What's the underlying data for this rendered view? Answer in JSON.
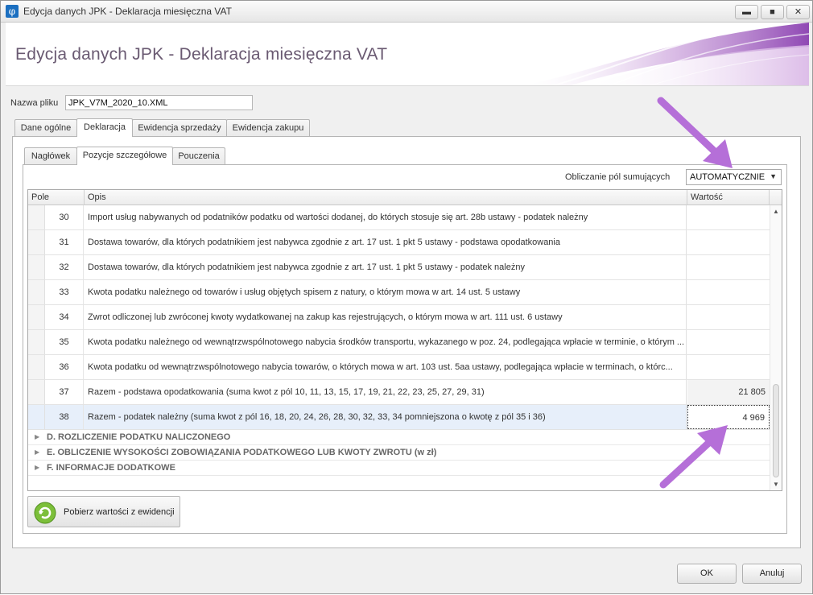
{
  "window": {
    "title": "Edycja danych JPK - Deklaracja miesięczna VAT",
    "buttons": {
      "minimize": "▬",
      "maximize": "■",
      "close": "✕"
    }
  },
  "header": {
    "title": "Edycja danych JPK - Deklaracja miesięczna VAT"
  },
  "file": {
    "label": "Nazwa pliku",
    "value": "JPK_V7M_2020_10.XML"
  },
  "main_tabs": [
    {
      "label": "Dane ogólne"
    },
    {
      "label": "Deklaracja"
    },
    {
      "label": "Ewidencja sprzedaży"
    },
    {
      "label": "Ewidencja zakupu"
    }
  ],
  "sub_tabs": [
    {
      "label": "Nagłówek"
    },
    {
      "label": "Pozycje szczegółowe"
    },
    {
      "label": "Pouczenia"
    }
  ],
  "calc": {
    "label": "Obliczanie pól sumujących",
    "value": "AUTOMATYCZNIE"
  },
  "grid": {
    "columns": {
      "pole": "Pole",
      "opis": "Opis",
      "wartosc": "Wartość"
    },
    "rows": [
      {
        "pole": "30",
        "opis": "Import usług nabywanych od podatników podatku od wartości dodanej, do których stosuje się art. 28b ustawy - podatek należny",
        "wartosc": ""
      },
      {
        "pole": "31",
        "opis": "Dostawa towarów, dla których podatnikiem jest nabywca zgodnie z art. 17 ust. 1 pkt 5 ustawy - podstawa opodatkowania",
        "wartosc": ""
      },
      {
        "pole": "32",
        "opis": "Dostawa towarów, dla których podatnikiem jest nabywca zgodnie z art. 17 ust. 1 pkt 5 ustawy - podatek należny",
        "wartosc": ""
      },
      {
        "pole": "33",
        "opis": "Kwota podatku należnego od towarów i usług objętych spisem z natury, o którym mowa w art. 14 ust. 5 ustawy",
        "wartosc": ""
      },
      {
        "pole": "34",
        "opis": "Zwrot odliczonej lub zwróconej kwoty wydatkowanej na zakup kas rejestrujących, o którym mowa w art. 111 ust. 6 ustawy",
        "wartosc": ""
      },
      {
        "pole": "35",
        "opis": "Kwota podatku należnego od wewnątrzwspólnotowego nabycia środków transportu, wykazanego w poz. 24, podlegająca wpłacie w terminie, o którym ...",
        "wartosc": ""
      },
      {
        "pole": "36",
        "opis": "Kwota podatku od wewnątrzwspólnotowego nabycia towarów, o których mowa w art. 103 ust. 5aa ustawy, podlegająca wpłacie w terminach, o którc...",
        "wartosc": ""
      },
      {
        "pole": "37",
        "opis": "Razem - podstawa opodatkowania (suma kwot z pól 10, 11, 13, 15, 17, 19, 21, 22, 23, 25, 27, 29, 31)",
        "wartosc": "21 805"
      },
      {
        "pole": "38",
        "opis": "Razem - podatek należny (suma kwot z pól 16, 18, 20, 24, 26, 28, 30, 32, 33, 34 pomniejszona o kwotę z pól 35 i 36)",
        "wartosc": "4 969"
      }
    ],
    "groups": [
      {
        "label": "D. ROZLICZENIE PODATKU NALICZONEGO"
      },
      {
        "label": "E. OBLICZENIE WYSOKOŚCI ZOBOWIĄZANIA PODATKOWEGO LUB KWOTY ZWROTU (w zł)"
      },
      {
        "label": "F. INFORMACJE DODATKOWE"
      }
    ]
  },
  "fetch_button": {
    "label": "Pobierz wartości z ewidencji"
  },
  "footer": {
    "ok": "OK",
    "cancel": "Anuluj"
  },
  "colors": {
    "annotation_arrow": "#b56fd8",
    "header_title": "#6a5a72",
    "selection": "#e7effa"
  }
}
